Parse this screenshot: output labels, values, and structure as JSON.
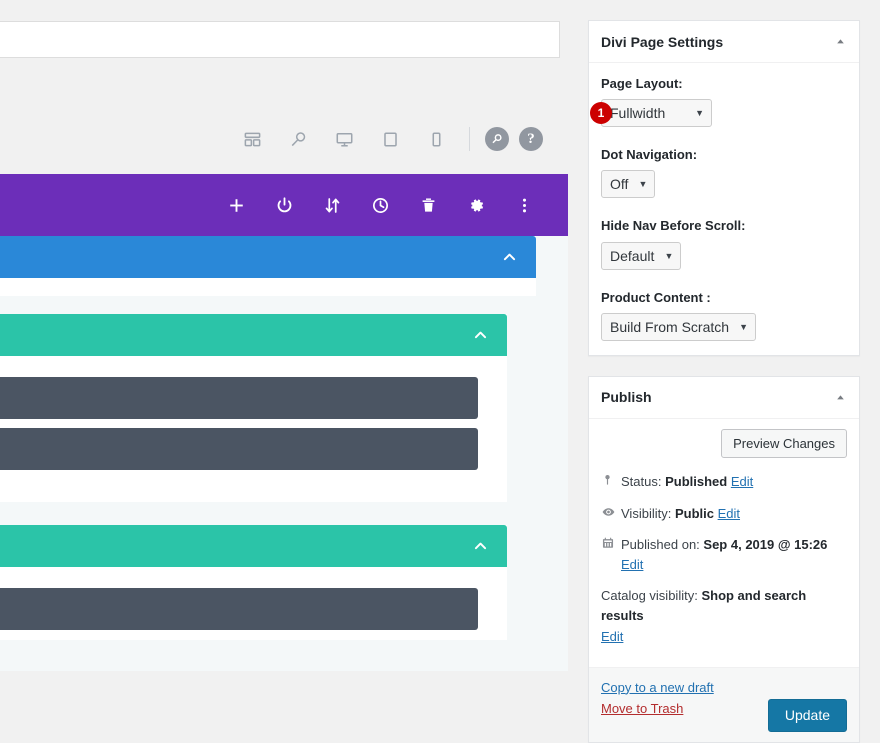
{
  "editor": {
    "title_field": {
      "value": "",
      "placeholder": ""
    },
    "toolbar_icons": [
      {
        "name": "wireframe-view-icon",
        "label": "Wireframe View"
      },
      {
        "name": "zoom-out-view-icon",
        "label": "Zoom Out"
      },
      {
        "name": "desktop-view-icon",
        "label": "Desktop View"
      },
      {
        "name": "tablet-view-icon",
        "label": "Tablet View"
      },
      {
        "name": "phone-view-icon",
        "label": "Phone View"
      },
      {
        "name": "search-circle-icon",
        "label": "Search"
      },
      {
        "name": "help-circle-icon",
        "label": "Help"
      }
    ],
    "help_glyph": "?",
    "purple_bar": {
      "color": "#6c2eb9",
      "icons": [
        {
          "name": "add-section-icon",
          "label": "Add New Section"
        },
        {
          "name": "power-toggle-icon",
          "label": "Toggle Builder"
        },
        {
          "name": "sort-arrows-icon",
          "label": "Reorder"
        },
        {
          "name": "history-clock-icon",
          "label": "Editing History"
        },
        {
          "name": "trash-icon",
          "label": "Clear Layout"
        },
        {
          "name": "settings-gear-icon",
          "label": "Page Settings"
        },
        {
          "name": "more-options-icon",
          "label": "More Options"
        }
      ]
    },
    "builder": {
      "sections": [
        {
          "name": "section-blue",
          "color": "#2a88d8",
          "label": "",
          "collapse_icon": "chevron-up-icon",
          "width_pct": 95,
          "modules": []
        },
        {
          "name": "section-teal-1",
          "color": "#2bc4a8",
          "label": "",
          "collapse_icon": "chevron-up-icon",
          "width_pct": 90,
          "modules": [
            {
              "name": "module-block",
              "label": "",
              "color": "#4b5563"
            },
            {
              "name": "module-block",
              "label": "",
              "color": "#4b5563"
            }
          ]
        },
        {
          "name": "section-teal-2",
          "color": "#2bc4a8",
          "label": "",
          "collapse_icon": "chevron-up-icon",
          "width_pct": 90,
          "modules": [
            {
              "name": "module-block",
              "label": "",
              "color": "#4b5563"
            }
          ]
        }
      ]
    }
  },
  "sidebar": {
    "divi_panel": {
      "title": "Divi Page Settings",
      "toggle_icon": "chevron-up-icon",
      "fields": [
        {
          "label": "Page Layout:",
          "value": "Fullwidth",
          "arrow": "▼",
          "badge": "1",
          "badge_color": "#cc0000",
          "name": "page-layout-select"
        },
        {
          "label": "Dot Navigation:",
          "value": "Off",
          "arrow": "▼",
          "name": "dot-navigation-select"
        },
        {
          "label": "Hide Nav Before Scroll:",
          "value": "Default",
          "arrow": "▼",
          "name": "hide-nav-select"
        },
        {
          "label": "Product Content :",
          "value": "Build From Scratch",
          "arrow": "▼",
          "name": "product-content-select"
        }
      ]
    },
    "publish_panel": {
      "title": "Publish",
      "toggle_icon": "chevron-up-icon",
      "preview_button": "Preview Changes",
      "status": {
        "icon": "pin-icon",
        "label": "Status:",
        "value": "Published",
        "edit_link": "Edit"
      },
      "visibility": {
        "icon": "eye-icon",
        "label": "Visibility:",
        "value": "Public",
        "edit_link": "Edit"
      },
      "published_on": {
        "icon": "calendar-icon",
        "label": "Published on:",
        "value": "Sep 4, 2019 @ 15:26",
        "edit_link": "Edit"
      },
      "catalog_visibility": {
        "label": "Catalog visibility:",
        "value": "Shop and search results",
        "edit_link": "Edit"
      },
      "copy_draft_link": "Copy to a new draft",
      "trash_link": "Move to Trash",
      "update_button": "Update",
      "update_button_color": "#1577a5"
    }
  }
}
